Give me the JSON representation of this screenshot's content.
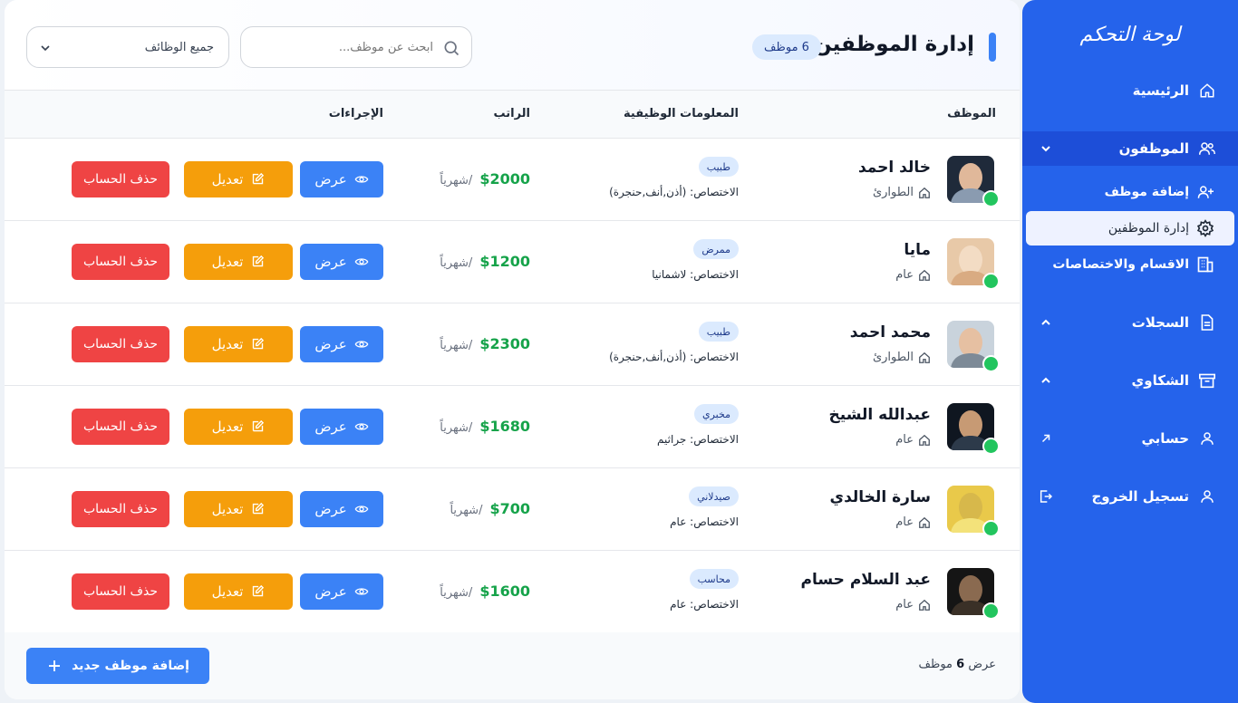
{
  "sidebar": {
    "title": "لوحة التحكم",
    "items": {
      "home": "الرئيسية",
      "employees": "الموظفون",
      "add_employee": "إضافة موظف",
      "manage_employees": "إدارة الموظفين",
      "departments": "الاقسام والاختصاصات",
      "records": "السجلات",
      "complaints": "الشكاوي",
      "account": "حسابي",
      "logout": "تسجيل الخروج"
    }
  },
  "header": {
    "title": "إدارة الموظفين",
    "count_badge": "6 موظف",
    "search_placeholder": "ابحث عن موظف...",
    "filter_value": "جميع الوظائف"
  },
  "table": {
    "columns": {
      "employee": "الموظف",
      "job_info": "المعلومات الوظيفية",
      "salary": "الراتب",
      "actions": "الإجراءات"
    },
    "spec_prefix": "الاختصاص:",
    "per_month": "/شهرياً",
    "buttons": {
      "view": "عرض",
      "edit": "تعديل",
      "delete": "حذف الحساب"
    },
    "rows": [
      {
        "name": "خالد احمد",
        "dept": "الطوارئ",
        "role": "طبيب",
        "spec": "الاختصاص: (أذن,أنف,حنجرة)",
        "salary": "$2000"
      },
      {
        "name": "مايا",
        "dept": "عام",
        "role": "ممرض",
        "spec": "الاختصاص: لاشمانيا",
        "salary": "$1200"
      },
      {
        "name": "محمد احمد",
        "dept": "الطوارئ",
        "role": "طبيب",
        "spec": "الاختصاص: (أذن,أنف,حنجرة)",
        "salary": "$2300"
      },
      {
        "name": "عبدالله الشيخ",
        "dept": "عام",
        "role": "مخبري",
        "spec": "الاختصاص: جراثيم",
        "salary": "$1680"
      },
      {
        "name": "سارة الخالدي",
        "dept": "عام",
        "role": "صيدلاني",
        "spec": "الاختصاص: عام",
        "salary": "$700"
      },
      {
        "name": "عبد السلام حسام",
        "dept": "عام",
        "role": "محاسب",
        "spec": "الاختصاص: عام",
        "salary": "$1600"
      }
    ]
  },
  "footer": {
    "showing_prefix": "عرض",
    "showing_count": "6",
    "showing_suffix": "موظف",
    "add_button": "إضافة موظف جديد"
  },
  "colors": {
    "primary": "#2563eb",
    "view": "#3b82f6",
    "edit": "#f59e0b",
    "delete": "#ef4444",
    "salary": "#16a34a",
    "online": "#22c55e"
  }
}
